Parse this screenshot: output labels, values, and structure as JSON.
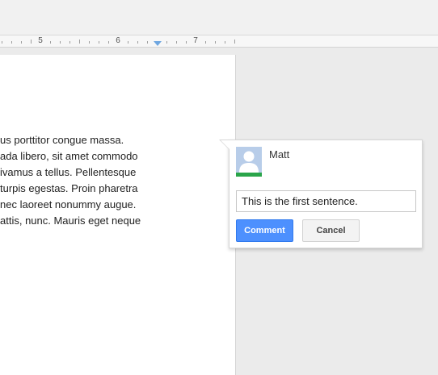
{
  "ruler": {
    "numbers": [
      "5",
      "6",
      "7"
    ]
  },
  "document": {
    "lines": [
      "us porttitor congue massa.",
      "ada libero, sit amet commodo",
      "ivamus a tellus. Pellentesque",
      "turpis egestas. Proin pharetra",
      "nec laoreet nonummy augue.",
      "attis, nunc. Mauris eget neque"
    ]
  },
  "comment": {
    "author": "Matt",
    "avatar_icon": "user-silhouette-icon",
    "input_value": "This is the first sentence.",
    "comment_label": "Comment",
    "cancel_label": "Cancel"
  },
  "colors": {
    "accent_blue": "#4d90fe",
    "avatar_green": "#2aa54a"
  }
}
